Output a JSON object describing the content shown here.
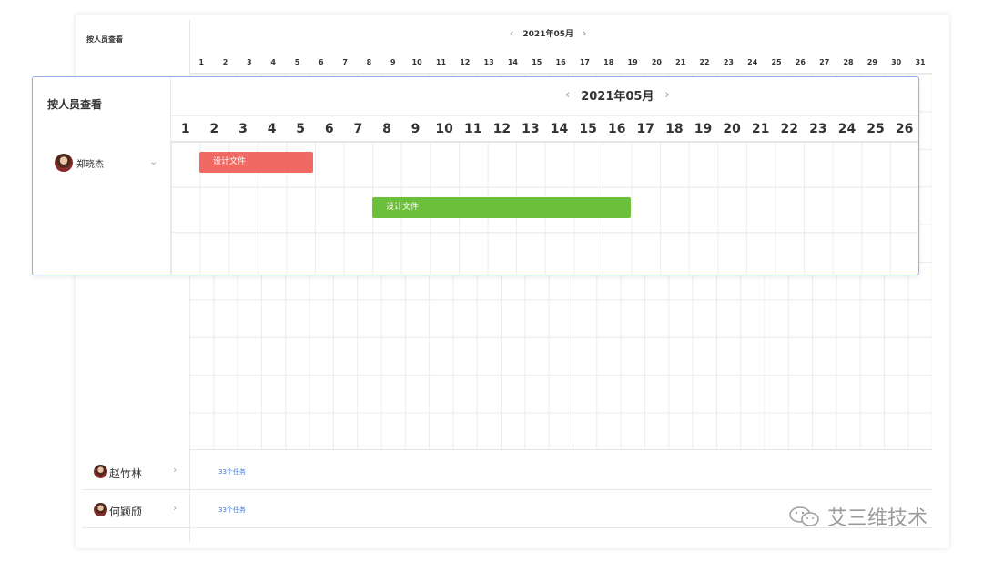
{
  "background_view": {
    "title": "按人员查看",
    "month_label": "2021年05月",
    "prev_arrow": "‹",
    "next_arrow": "›",
    "days": [
      "1",
      "2",
      "3",
      "4",
      "5",
      "6",
      "7",
      "8",
      "9",
      "10",
      "11",
      "12",
      "13",
      "14",
      "15",
      "16",
      "17",
      "18",
      "19",
      "20",
      "21",
      "22",
      "23",
      "24",
      "25",
      "26",
      "27",
      "28",
      "29",
      "30",
      "31"
    ],
    "people": [
      {
        "name": "赵竹林",
        "chevron": "›",
        "task_count": "33个任务"
      },
      {
        "name": "何颖颀",
        "chevron": "›",
        "task_count": "33个任务"
      }
    ]
  },
  "foreground_view": {
    "title": "按人员查看",
    "month_label": "2021年05月",
    "prev_arrow": "‹",
    "next_arrow": "›",
    "days": [
      "1",
      "2",
      "3",
      "4",
      "5",
      "6",
      "7",
      "8",
      "9",
      "10",
      "11",
      "12",
      "13",
      "14",
      "15",
      "16",
      "17",
      "18",
      "19",
      "20",
      "21",
      "22",
      "23",
      "24",
      "25",
      "26"
    ],
    "person": {
      "name": "郑晓杰",
      "chevron": "⌄"
    },
    "tasks": [
      {
        "label": "设计文件",
        "color": "#f06a63"
      },
      {
        "label": "设计文件",
        "color": "#6bbf3a"
      }
    ]
  },
  "watermark": {
    "text": "艾三维技术"
  },
  "colors": {
    "accent_blue": "#3b78e7",
    "border_blue": "#8fb2ee",
    "task_red": "#f06a63",
    "task_green": "#6bbf3a"
  }
}
